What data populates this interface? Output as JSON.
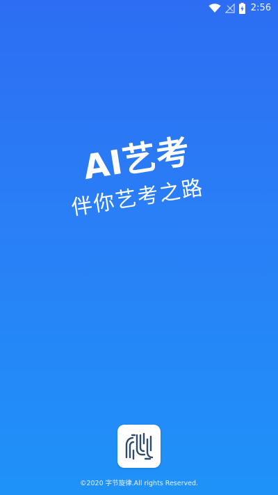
{
  "status_bar": {
    "time": "2:56",
    "icons": [
      "wifi-icon",
      "no-signal-icon",
      "battery-charging-icon"
    ]
  },
  "splash": {
    "title": "AI艺考",
    "subtitle": "伴你艺考之路"
  },
  "footer": {
    "copyright": "©2020 字节旋律.All rights Reserved."
  },
  "colors": {
    "gradient_top": "#2d6df3",
    "gradient_bottom": "#1f92f8",
    "logo_background": "#ffffff",
    "logo_stroke": "#2e4b67",
    "text": "#ffffff"
  }
}
